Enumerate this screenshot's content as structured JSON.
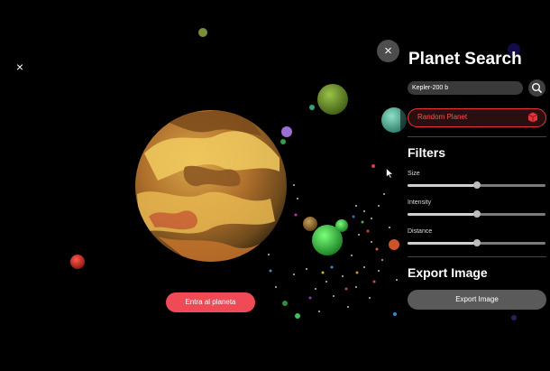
{
  "scene": {
    "close_label": "×",
    "enter_button_label": "Entra al planeta"
  },
  "panel": {
    "close_label": "×",
    "title": "Planet Search",
    "search": {
      "value": "Kepler-200 b",
      "icon": "search-icon"
    },
    "random_button_label": "Random Planet",
    "random_icon": "dice-icon",
    "filters_title": "Filters",
    "sliders": [
      {
        "label": "Size",
        "value": 0.5
      },
      {
        "label": "Intensity",
        "value": 0.5
      },
      {
        "label": "Distance",
        "value": 0.5
      }
    ],
    "export_title": "Export Image",
    "export_button_label": "Export Image"
  },
  "colors": {
    "accent_red": "#f04a57",
    "random_border": "#e8333b",
    "panel_bg": "#000000"
  }
}
